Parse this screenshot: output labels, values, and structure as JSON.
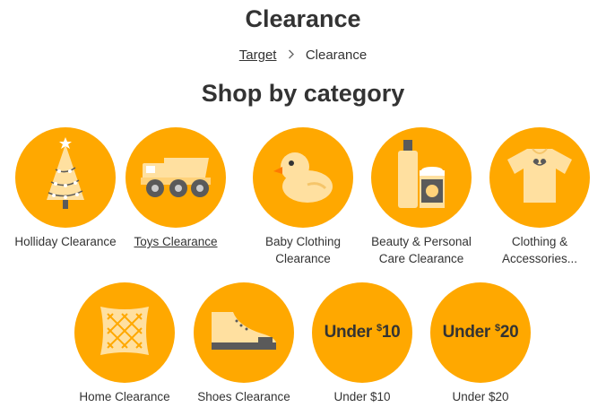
{
  "page": {
    "title": "Clearance",
    "section_title": "Shop by category"
  },
  "breadcrumb": {
    "items": [
      "Target",
      "Clearance"
    ],
    "separator": ">"
  },
  "colors": {
    "circle": "#ffa800",
    "icon_light": "#ffe0a0",
    "icon_dark": "#5a5a5a",
    "text": "#333333"
  },
  "categories": [
    {
      "label": "Holliday Clearance",
      "icon": "christmas-tree-icon"
    },
    {
      "label": "Toys Clearance",
      "icon": "dump-truck-icon",
      "underlined": true
    },
    {
      "label": "Baby Clothing Clearance",
      "icon": "rubber-duck-icon"
    },
    {
      "label": "Beauty & Personal Care Clearance",
      "icon": "beauty-products-icon"
    },
    {
      "label": "Clothing & Accessories...",
      "icon": "shirt-icon"
    },
    {
      "label": "Home Clearance",
      "icon": "pillow-icon"
    },
    {
      "label": "Shoes Clearance",
      "icon": "sneaker-icon"
    },
    {
      "label": "Under $10",
      "icon": "under-10-badge",
      "badge_text": "Under",
      "badge_price": "$10"
    },
    {
      "label": "Under $20",
      "icon": "under-20-badge",
      "badge_text": "Under",
      "badge_price": "$20"
    }
  ]
}
